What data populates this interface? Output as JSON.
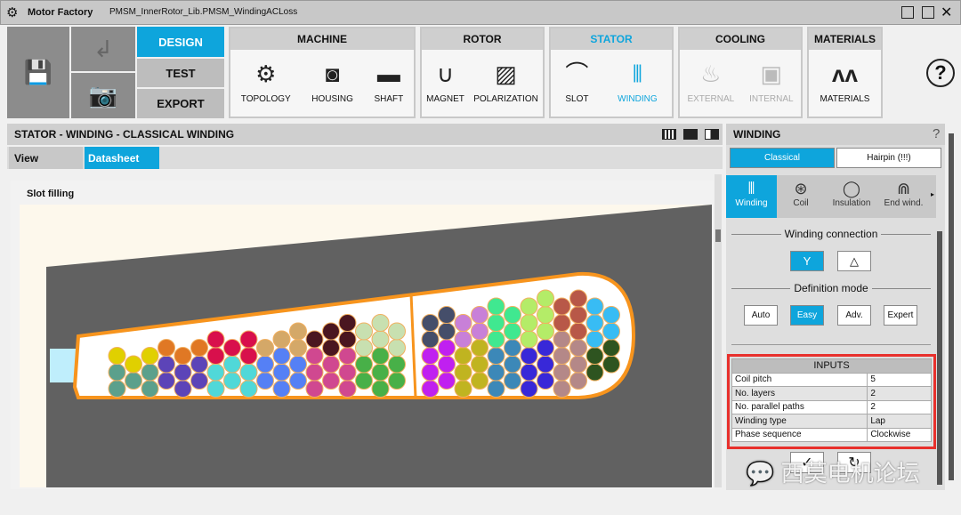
{
  "window": {
    "app_name": "Motor Factory",
    "document": "PMSM_InnerRotor_Lib.PMSM_WindingACLoss"
  },
  "nav": {
    "design": "DESIGN",
    "test": "TEST",
    "export": "EXPORT"
  },
  "groups": [
    {
      "title": "MACHINE",
      "items": [
        {
          "label": "TOPOLOGY",
          "icon": "topology-icon"
        },
        {
          "label": "HOUSING",
          "icon": "housing-icon"
        },
        {
          "label": "SHAFT",
          "icon": "shaft-icon"
        }
      ]
    },
    {
      "title": "ROTOR",
      "items": [
        {
          "label": "MAGNET",
          "icon": "magnet-icon"
        },
        {
          "label": "POLARIZATION",
          "icon": "polarization-icon"
        }
      ]
    },
    {
      "title": "STATOR",
      "items": [
        {
          "label": "SLOT",
          "icon": "slot-icon"
        },
        {
          "label": "WINDING",
          "icon": "winding-icon"
        }
      ]
    },
    {
      "title": "COOLING",
      "items": [
        {
          "label": "EXTERNAL",
          "icon": "external-cooling-icon"
        },
        {
          "label": "INTERNAL",
          "icon": "internal-cooling-icon"
        }
      ]
    },
    {
      "title": "MATERIALS",
      "items": [
        {
          "label": "MATERIALS",
          "icon": "materials-icon"
        }
      ]
    }
  ],
  "main": {
    "title": "STATOR - WINDING - CLASSICAL WINDING",
    "view_label": "View",
    "tab": "Datasheet",
    "section": "Slot filling"
  },
  "slot": {
    "outline_color": "#f7941d",
    "stator_color": "#616161",
    "background": "#fdf8ec",
    "layer_colors": [
      [
        "#e0d000",
        "#5ba08c",
        "#e07824",
        "#5c44b8",
        "#d8104c",
        "#50d8d8",
        "#d4a868",
        "#5580f5",
        "#4a1620",
        "#d04890",
        "#c8e0b0",
        "#48b048"
      ],
      [
        "#454e6a",
        "#c020f0",
        "#c880d8",
        "#c0b420",
        "#40e890",
        "#3c88b8",
        "#b4ec68",
        "#3828d8",
        "#b85848",
        "#b48888",
        "#38bcf4",
        "#2e5420"
      ]
    ]
  },
  "winding": {
    "title": "WINDING",
    "help": "?",
    "type_tabs": [
      "Classical",
      "Hairpin (!!!)"
    ],
    "sub_tabs": [
      {
        "label": "Winding",
        "icon": "winding-icon"
      },
      {
        "label": "Coil",
        "icon": "coil-icon"
      },
      {
        "label": "Insulation",
        "icon": "insulation-icon"
      },
      {
        "label": "End wind.",
        "icon": "end-winding-icon"
      }
    ],
    "connection_label": "Winding connection",
    "connection": [
      "Y",
      "△"
    ],
    "mode_label": "Definition mode",
    "modes": [
      "Auto",
      "Easy",
      "Adv.",
      "Expert"
    ],
    "inputs_title": "INPUTS",
    "inputs": [
      [
        "Coil pitch",
        "5"
      ],
      [
        "No. layers",
        "2"
      ],
      [
        "No. parallel paths",
        "2"
      ],
      [
        "Winding type",
        "Lap"
      ],
      [
        "Phase sequence",
        "Clockwise"
      ]
    ],
    "watermark": "西莫电机论坛"
  }
}
